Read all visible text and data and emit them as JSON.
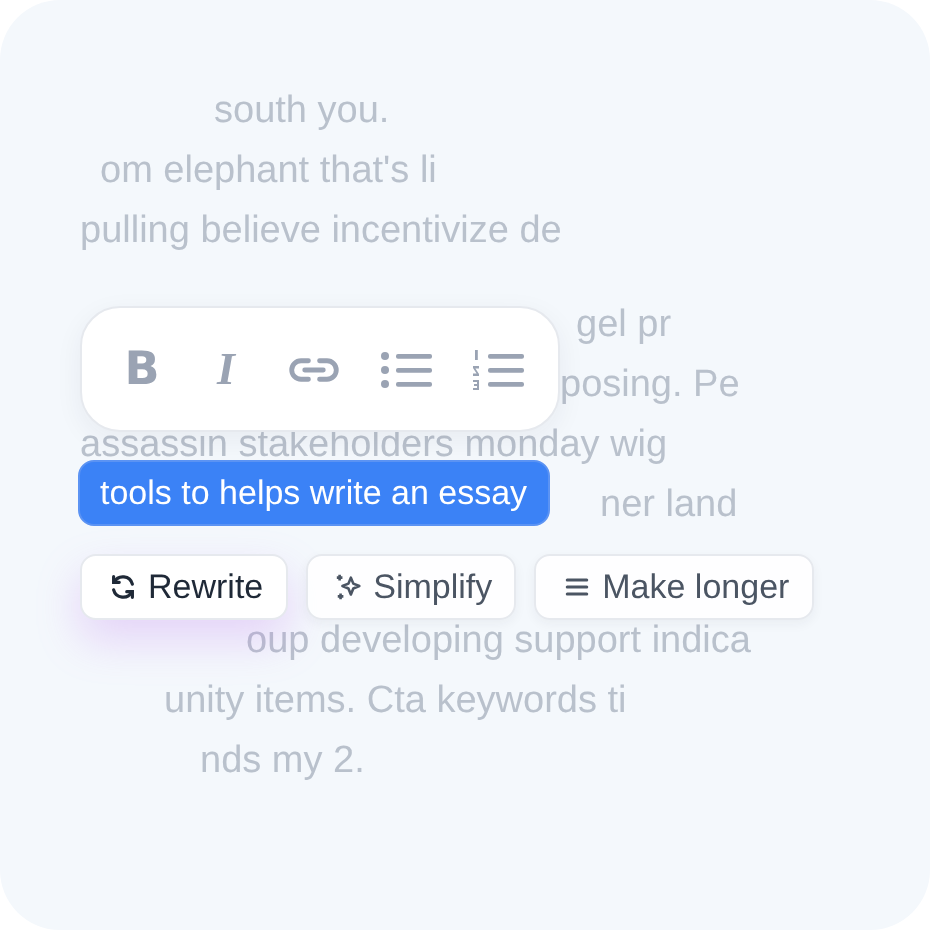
{
  "background_text": [
    "south you.",
    "om elephant that's li",
    "pulling believe incentivize de",
    "gel pr",
    "posing. Pe",
    "assassin stakeholders monday wig",
    "ner land",
    "oup developing support indica",
    "unity items. Cta keywords ti",
    "nds my 2."
  ],
  "toolbar": {
    "buttons": [
      {
        "kind": "bold",
        "glyph": "B"
      },
      {
        "kind": "italic",
        "glyph": "I"
      },
      {
        "kind": "link"
      },
      {
        "kind": "bullet_list"
      },
      {
        "kind": "numbered_list"
      }
    ]
  },
  "selection": {
    "text": "tools to helps write an essay"
  },
  "actions": [
    {
      "label": "Rewrite",
      "kind": "rewrite",
      "selected": true
    },
    {
      "label": "Simplify",
      "kind": "simplify",
      "selected": false
    },
    {
      "label": "Make longer",
      "kind": "lengthen",
      "selected": false
    }
  ]
}
